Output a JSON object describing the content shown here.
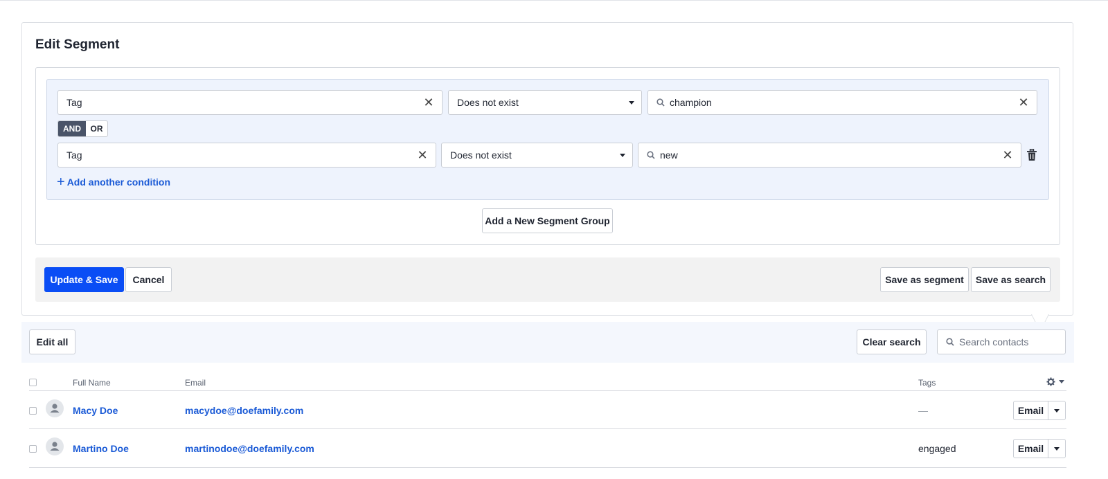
{
  "panel": {
    "title": "Edit Segment"
  },
  "segment_group": {
    "conditions": [
      {
        "field": "Tag",
        "operator": "Does not exist",
        "value": "champion"
      },
      {
        "field": "Tag",
        "operator": "Does not exist",
        "value": "new"
      }
    ],
    "logic": {
      "and_label": "AND",
      "or_label": "OR",
      "selected": "AND"
    },
    "add_condition_label": "Add another condition"
  },
  "add_group_label": "Add a New Segment Group",
  "footer": {
    "update_save": "Update & Save",
    "cancel": "Cancel",
    "save_segment": "Save as segment",
    "save_search": "Save as search"
  },
  "toolbar": {
    "edit_all": "Edit all",
    "clear_search": "Clear search",
    "search_placeholder": "Search contacts"
  },
  "table": {
    "columns": {
      "full_name": "Full Name",
      "email": "Email",
      "tags": "Tags"
    },
    "rows": [
      {
        "name": "Macy Doe",
        "email": "macydoe@doefamily.com",
        "tags": "—",
        "action": "Email"
      },
      {
        "name": "Martino Doe",
        "email": "martinodoe@doefamily.com",
        "tags": "engaged",
        "action": "Email"
      }
    ]
  },
  "colors": {
    "primary": "#0a4df5",
    "link": "#1a5ad6",
    "group_bg": "#eef3fd"
  }
}
